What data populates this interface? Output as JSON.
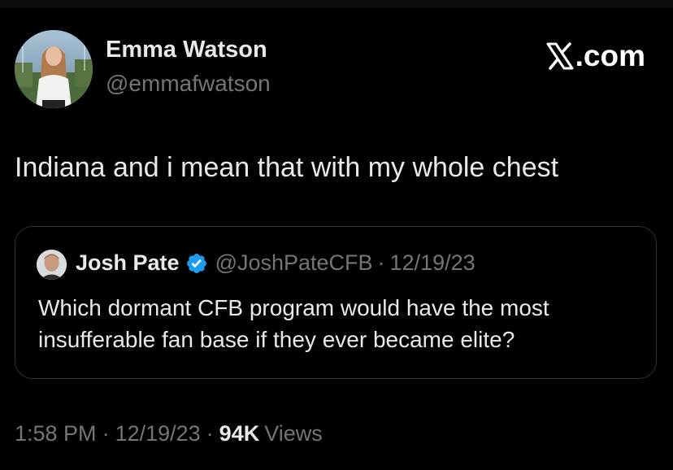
{
  "author": {
    "name": "Emma Watson",
    "handle": "@emmafwatson"
  },
  "brand": {
    "x_glyph": "𝕏",
    "domain_suffix": ".com"
  },
  "tweet": {
    "text": "Indiana and i mean that with my whole chest"
  },
  "quoted_tweet": {
    "author_name": "Josh Pate",
    "author_handle": "@JoshPateCFB",
    "separator": "·",
    "date": "12/19/23",
    "verified": true,
    "text_line_1": "Which dormant CFB program would have the most",
    "text_line_2": "insufferable fan base if they ever became elite?"
  },
  "meta": {
    "time": "1:58 PM",
    "separator": "·",
    "date": "12/19/23",
    "views_count": "94K",
    "views_label": "Views"
  },
  "colors": {
    "background": "#000000",
    "primary_text": "#e7e9ea",
    "secondary_text": "#71767b",
    "border": "#2f3336",
    "verified_badge": "#1d9bf0"
  },
  "icons": {
    "verified": "verified-badge-icon",
    "brand": "x-logo-icon"
  }
}
